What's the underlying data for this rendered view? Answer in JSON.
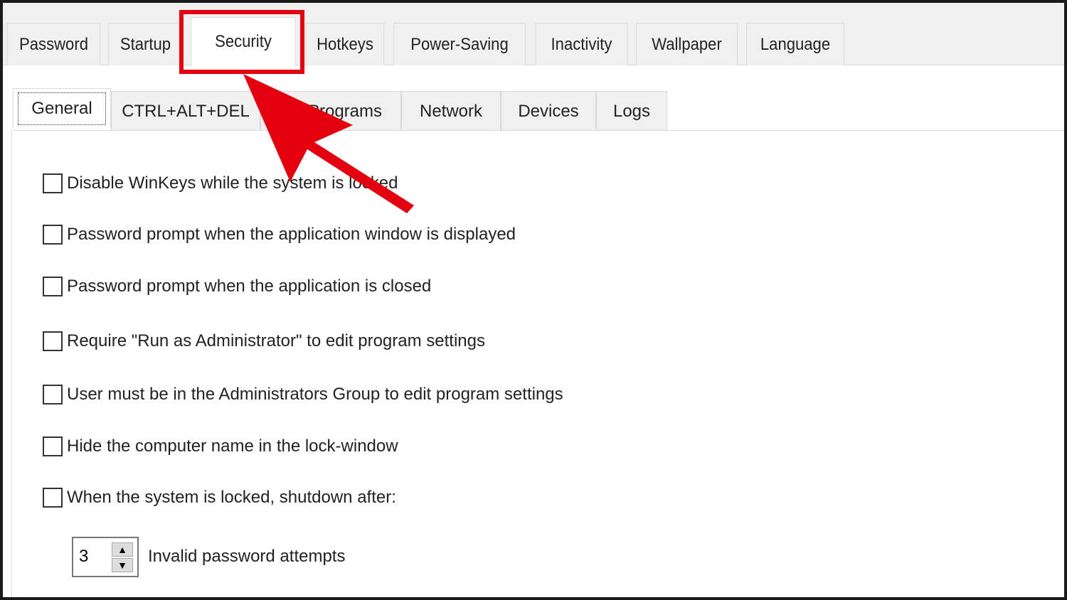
{
  "top_tabs": [
    "Password",
    "Startup",
    "Security",
    "Hotkeys",
    "Power-Saving",
    "Inactivity",
    "Wallpaper",
    "Language"
  ],
  "selected_top_tab": "Security",
  "sub_tabs": [
    "General",
    "CTRL+ALT+DEL",
    "Programs",
    "Network",
    "Devices",
    "Logs"
  ],
  "selected_sub_tab": "General",
  "options": [
    {
      "label": "Disable WinKeys while the system is locked",
      "checked": false
    },
    {
      "label": "Password prompt when the application window is displayed",
      "checked": false
    },
    {
      "label": "Password prompt when the application is closed",
      "checked": false
    },
    {
      "label": "Require \"Run as Administrator\" to edit program settings",
      "checked": false
    },
    {
      "label": "User must be in the Administrators Group to edit program settings",
      "checked": false
    },
    {
      "label": "Hide the computer name in the lock-window",
      "checked": false
    },
    {
      "label": "When the system is locked, shutdown after:",
      "checked": false
    }
  ],
  "attempts": {
    "value": "3",
    "label": "Invalid password attempts"
  },
  "annotation": {
    "color": "#e3000f",
    "highlight": "Security tab",
    "arrow_icon": "red-arrow"
  }
}
